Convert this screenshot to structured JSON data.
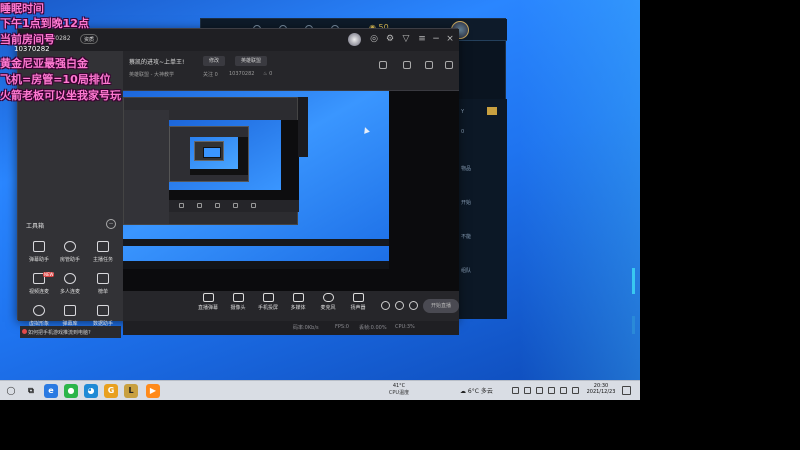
{
  "overlay": {
    "line1": "睡眠时间",
    "line2": "下午1点到晚12点",
    "line3": "当前房间号",
    "line4": "10370282",
    "line5": "黄金尼亚最强白金",
    "line6": "飞机=房管=10局排位",
    "line7": "火箭老板可以坐我家号玩"
  },
  "app": {
    "id": "10370282",
    "tag": "资质",
    "stream_title": "蔡凯的进攻~上单王!",
    "chip_edit": "修改",
    "chip_category": "英雄联盟",
    "meta_category": "英雄联盟 - 大神教学",
    "meta_fans": "关注 0",
    "meta_room": "10370282",
    "meta_heat": "0"
  },
  "tools": {
    "title": "工具箱",
    "items": [
      {
        "label": "弹幕助手"
      },
      {
        "label": "房管助手"
      },
      {
        "label": "主播任务"
      },
      {
        "label": "视频连麦",
        "badge": "NEW"
      },
      {
        "label": "多人连麦"
      },
      {
        "label": "榜单"
      },
      {
        "label": "虚拟形象"
      },
      {
        "label": "弹幕库"
      },
      {
        "label": "数据助手"
      },
      {
        "label": "PK",
        "badge": "NEW"
      },
      {
        "label": "口令红包"
      },
      {
        "label": "更多"
      }
    ],
    "tip": "如何把手机游戏推流到电脑?"
  },
  "controls": [
    {
      "label": "直播弹幕"
    },
    {
      "label": "摄像头"
    },
    {
      "label": "手机投屏"
    },
    {
      "label": "多媒体"
    },
    {
      "label": "麦克风"
    },
    {
      "label": "扬声器"
    }
  ],
  "start_live": "开始直播",
  "status": {
    "fps": "码率:0Kb/s",
    "cpu": "FPS:0",
    "mem": "丢帧:0.00%",
    "net": "CPU:3%",
    "time": "00:00:00"
  },
  "game": {
    "coins": "50",
    "side_labels": [
      "Y",
      "0",
      "物品",
      "开始",
      "不能",
      "组队"
    ]
  },
  "taskbar": {
    "cpu_temp": "41°C",
    "cpu_label": "CPU温度",
    "weather": "6°C 多云",
    "time": "20:30",
    "date": "2021/12/23"
  },
  "colors": {
    "overlay_text": "#ff7ad2",
    "desktop": "#2a86ff",
    "app_bg": "#2b2b2f"
  }
}
